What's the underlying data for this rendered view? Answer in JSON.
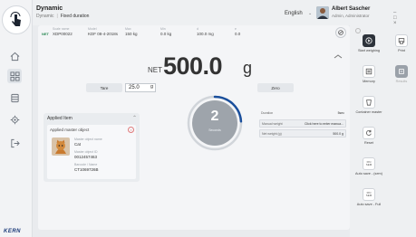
{
  "app": {
    "title": "Dynamic",
    "breadcrumb_parent": "Dynamic",
    "mode": "Fixed duration",
    "language": "English",
    "user_name": "Albert Sascher",
    "user_role": "Admin, Administrator",
    "window_controls": "–  □  ×",
    "brand": "KERN"
  },
  "info_strip": {
    "net_badge": "NET",
    "cols": [
      {
        "label": "Scale name",
        "value": "XDP00022"
      },
      {
        "label": "Model",
        "value": "KDF 08-4-2018s"
      },
      {
        "label": "Max",
        "value": "150 kg"
      },
      {
        "label": "Min",
        "value": "0.0 kg"
      },
      {
        "label": "d",
        "value": "100.0 mg"
      },
      {
        "label": "e",
        "value": "0.0"
      }
    ]
  },
  "weighing": {
    "net_label": "NET",
    "value": "500.0",
    "unit": "g",
    "tare_label": "Tare",
    "tare_value": "25.0",
    "tare_unit": "g",
    "zero_label": "Zero"
  },
  "countdown": {
    "value": "2",
    "label": "Seconds",
    "progress": 0.24
  },
  "applied_item": {
    "title": "Applied Item",
    "inner_title": "Applied master object",
    "fields": [
      {
        "label": "Master object name",
        "value": "Cat"
      },
      {
        "label": "Master object ID",
        "value": "0012457463"
      },
      {
        "label": "Barcode / Name",
        "value": "CT1069726B"
      }
    ]
  },
  "right_fields": [
    {
      "label": "Duration",
      "value": "5sec"
    },
    {
      "label": "Manual weight",
      "value": "Click here to enter manua..."
    },
    {
      "label": "Net weight (g)",
      "value": "500.0 g"
    }
  ],
  "actions": [
    {
      "label": "Start weighing",
      "icon": "play-icon"
    },
    {
      "label": "Print",
      "icon": "print-icon"
    },
    {
      "label": "Memory",
      "icon": "memory-icon"
    },
    {
      "label": "Results",
      "icon": "results-icon"
    },
    {
      "label": "Container master",
      "icon": "container-icon"
    },
    {
      "label": "Reset",
      "icon": "reset-icon"
    },
    {
      "label": "Auto save - (sem)",
      "icon": "auto-save-icon"
    },
    {
      "label": "Auto save - Full",
      "icon": "auto-save-full-icon"
    }
  ],
  "action_icon_text": {
    "auto_save": "FIN SEM",
    "auto_save_full": "FIN SEM"
  },
  "colors": {
    "accent": "#2d333b",
    "ring": "#9ea4ab",
    "ring_progress": "#1a4f9c"
  }
}
